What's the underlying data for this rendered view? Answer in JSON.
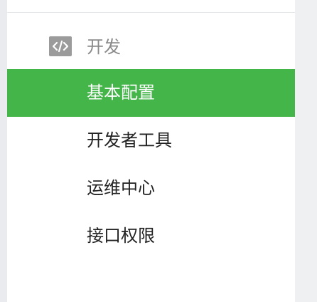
{
  "sidebar": {
    "group": {
      "icon": "code-icon",
      "label": "开发"
    },
    "items": [
      {
        "label": "基本配置",
        "active": true
      },
      {
        "label": "开发者工具",
        "active": false
      },
      {
        "label": "运维中心",
        "active": false
      },
      {
        "label": "接口权限",
        "active": false
      }
    ]
  },
  "colors": {
    "active_bg": "#44b549",
    "active_text": "#ffffff",
    "text": "#222222",
    "group_text": "#8a8a8a",
    "icon_bg": "#9b9b9b"
  }
}
